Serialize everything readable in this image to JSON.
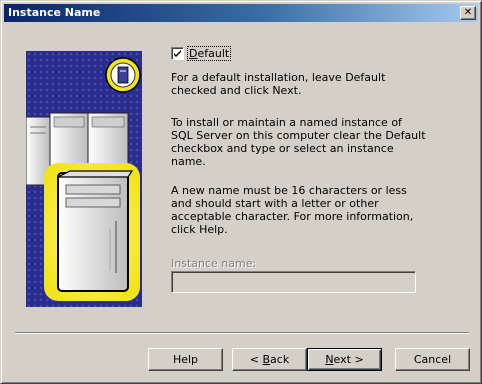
{
  "window": {
    "title": "Instance Name",
    "close_glyph": "✕",
    "titlebar_color": "#0a246a"
  },
  "art": {
    "icon": "servers-illustration",
    "colors": {
      "background": "#2c2f8e",
      "highlight": "#f5ec3a",
      "server": "#e8e8e8"
    }
  },
  "default_checkbox": {
    "label": "Default",
    "checked": true
  },
  "paragraphs": {
    "p1": "For a default installation, leave Default checked and click Next.",
    "p2": "To install or maintain a named instance of SQL Server on this computer clear the Default checkbox and type or select an instance name.",
    "p3": "A new name must be 16 characters or less and should start with a letter or other acceptable character.  For more information, click Help."
  },
  "instance_name": {
    "label": "Instance name:",
    "value": "",
    "enabled": false
  },
  "buttons": {
    "help": "Help",
    "back": "< Back",
    "next": "Next >",
    "cancel": "Cancel"
  }
}
